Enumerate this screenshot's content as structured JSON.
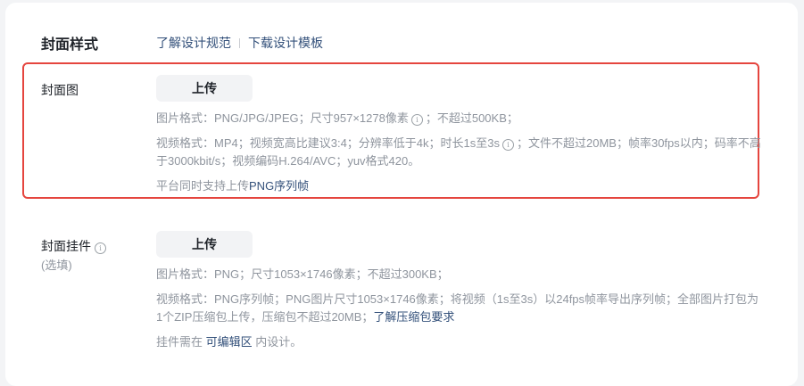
{
  "cover_style": {
    "title": "封面样式",
    "links": [
      "了解设计规范",
      "下载设计模板"
    ]
  },
  "cover_image": {
    "label": "封面图",
    "upload_label": "上传",
    "image_spec_a": "图片格式：PNG/JPG/JPEG；尺寸957×1278像素",
    "image_spec_b": "；不超过500KB；",
    "video_spec_a": "视频格式：MP4；视频宽高比建议3:4；分辨率低于4k；时长1s至3s",
    "video_spec_b": "；文件不超过20MB；帧率30fps以内；码率不高于3000kbit/s；视频编码H.264/AVC；yuv格式420。",
    "png_seq_prefix": "平台同时支持上传",
    "png_seq_link": "PNG序列帧"
  },
  "cover_widget": {
    "label": "封面挂件",
    "optional": "(选填)",
    "upload_label": "上传",
    "image_spec": "图片格式：PNG；尺寸1053×1746像素；不超过300KB；",
    "video_spec": "视频格式：PNG序列帧；PNG图片尺寸1053×1746像素；将视频（1s至3s）以24fps帧率导出序列帧；全部图片打包为1个ZIP压缩包上传，压缩包不超过20MB；",
    "zip_link": "了解压缩包要求",
    "note_prefix": "挂件需在",
    "note_link": "可编辑区",
    "note_suffix": "内设计。"
  },
  "colors": {
    "accent_link": "#33507a",
    "highlight_border": "#e5453e"
  }
}
